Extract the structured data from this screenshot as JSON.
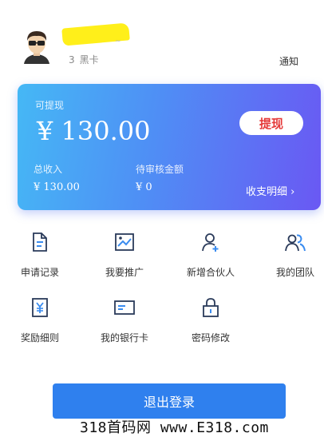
{
  "user": {
    "name_tail": "~",
    "id_suffix": "3",
    "tier": "黑卡"
  },
  "header": {
    "notify_label": "通知"
  },
  "balance_card": {
    "available_label": "可提现",
    "available_amount": "¥ 130.00",
    "withdraw_label": "提现",
    "total_income_label": "总收入",
    "total_income_value": "¥ 130.00",
    "pending_label": "待审核金额",
    "pending_value": "¥ 0",
    "detail_link_label": "收支明细 ›"
  },
  "menu": {
    "items": [
      {
        "label": "申请记录",
        "icon": "document-icon"
      },
      {
        "label": "我要推广",
        "icon": "image-chart-icon"
      },
      {
        "label": "新增合伙人",
        "icon": "add-user-icon"
      },
      {
        "label": "我的团队",
        "icon": "team-icon"
      },
      {
        "label": "奖励细则",
        "icon": "yen-doc-icon"
      },
      {
        "label": "我的银行卡",
        "icon": "bank-card-icon"
      },
      {
        "label": "密码修改",
        "icon": "lock-icon"
      }
    ]
  },
  "logout_label": "退出登录",
  "watermark": "318首码网 www.E318.com",
  "colors": {
    "accent": "#2f80ee",
    "card_start": "#45b8f5",
    "card_end": "#6a58f3",
    "highlight": "#ffef1a",
    "withdraw_text": "#e53838"
  }
}
